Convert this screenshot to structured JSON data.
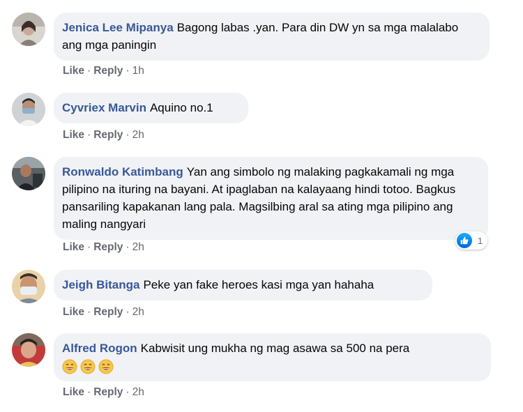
{
  "comments": [
    {
      "author": "Jenica Lee Mipanya",
      "text": "Bagong labas .yan. Para din DW yn sa mga malalabo ang mga paningin",
      "actions": {
        "like": "Like",
        "reply": "Reply",
        "time": "1h"
      }
    },
    {
      "author": "Cyvriex Marvin",
      "text": "Aquino no.1",
      "actions": {
        "like": "Like",
        "reply": "Reply",
        "time": "2h"
      }
    },
    {
      "author": "Ronwaldo Katimbang",
      "text": "Yan ang simbolo ng malaking pagkakamali ng mga pilipino na ituring na bayani. At ipaglaban na kalayaang hindi totoo. Bagkus pansariling kapakanan lang pala. Magsilbing aral sa ating mga pilipino ang maling nangyari",
      "actions": {
        "like": "Like",
        "reply": "Reply",
        "time": "2h"
      },
      "reaction": {
        "icon": "like-icon",
        "count": "1"
      }
    },
    {
      "author": "Jeigh Bitanga",
      "text": "Peke yan fake heroes kasi mga yan hahaha",
      "actions": {
        "like": "Like",
        "reply": "Reply",
        "time": "2h"
      }
    },
    {
      "author": "Alfred Rogon",
      "text": "Kabwisit ung mukha ng mag asawa sa 500 na pera",
      "emojis": [
        "grinning-face-icon",
        "grinning-face-icon",
        "grinning-face-icon"
      ],
      "actions": {
        "like": "Like",
        "reply": "Reply",
        "time": "2h"
      }
    }
  ],
  "colors": {
    "author": "#385898",
    "bubble": "#f0f2f5",
    "meta": "#65676b",
    "like_blue": "#1877f2"
  }
}
